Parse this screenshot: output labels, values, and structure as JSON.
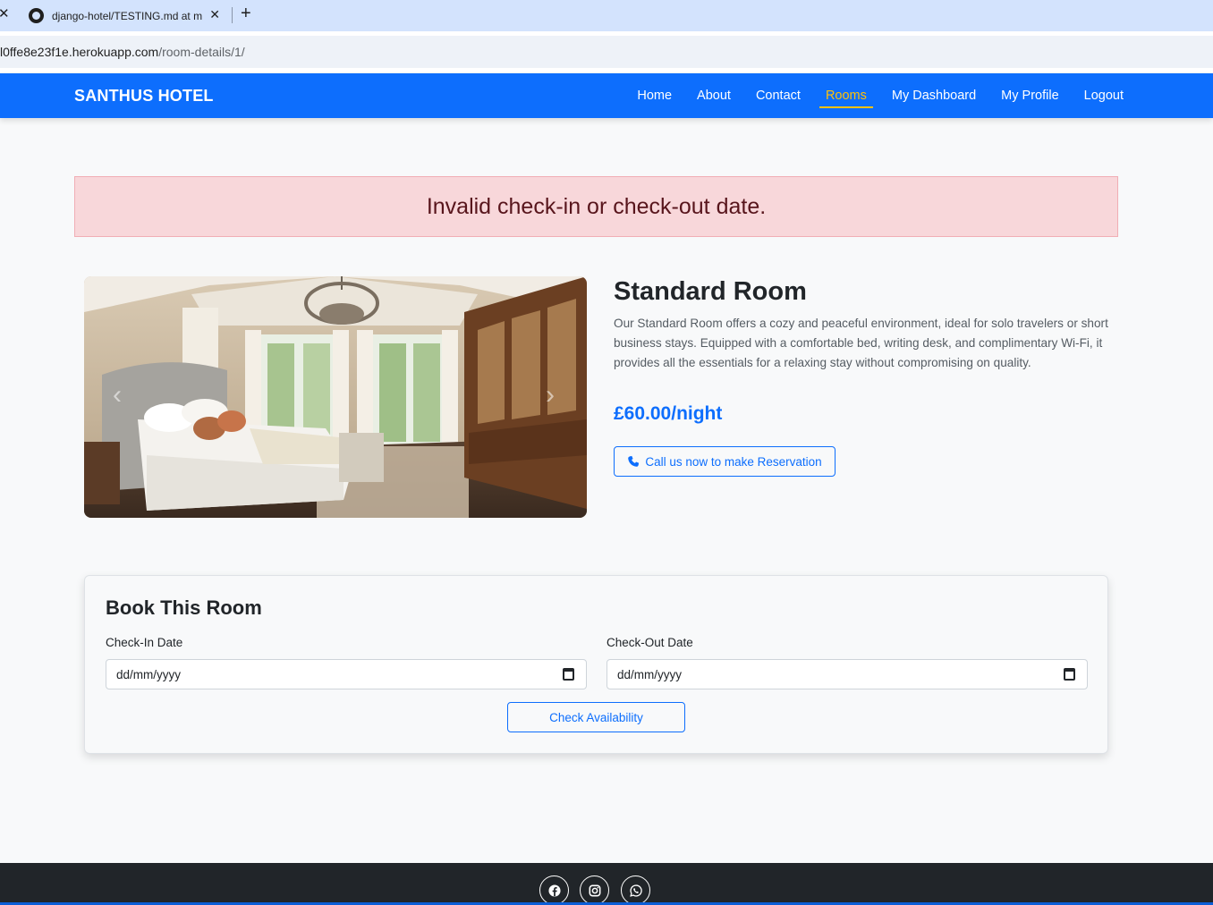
{
  "browser": {
    "tab_title": "django-hotel/TESTING.md at m",
    "url_host": "l0ffe8e23f1e.herokuapp.com",
    "url_path": "/room-details/1/"
  },
  "navbar": {
    "brand": "SANTHUS HOTEL",
    "links": [
      "Home",
      "About",
      "Contact",
      "Rooms",
      "My Dashboard",
      "My Profile",
      "Logout"
    ],
    "active": "Rooms"
  },
  "alert": {
    "message": "Invalid check-in or check-out date."
  },
  "room": {
    "title": "Standard Room",
    "description": "Our Standard Room offers a cozy and peaceful environment, ideal for solo travelers or short business stays. Equipped with a comfortable bed, writing desk, and complimentary Wi-Fi, it provides all the essentials for a relaxing stay without compromising on quality.",
    "price": "£60.00/night",
    "call_button": "Call us now to make Reservation"
  },
  "booking": {
    "title": "Book This Room",
    "checkin_label": "Check-In Date",
    "checkin_value": "dd/mm/yyyy",
    "checkout_label": "Check-Out Date",
    "checkout_value": "dd/mm/yyyy",
    "submit": "Check Availability"
  },
  "footer": {
    "social_icons": [
      "facebook-icon",
      "instagram-icon",
      "whatsapp-icon"
    ]
  },
  "colors": {
    "primary": "#0d6efd",
    "active_nav": "#ffc107",
    "alert_bg": "#f8d7da",
    "footer_bg": "#212529"
  }
}
